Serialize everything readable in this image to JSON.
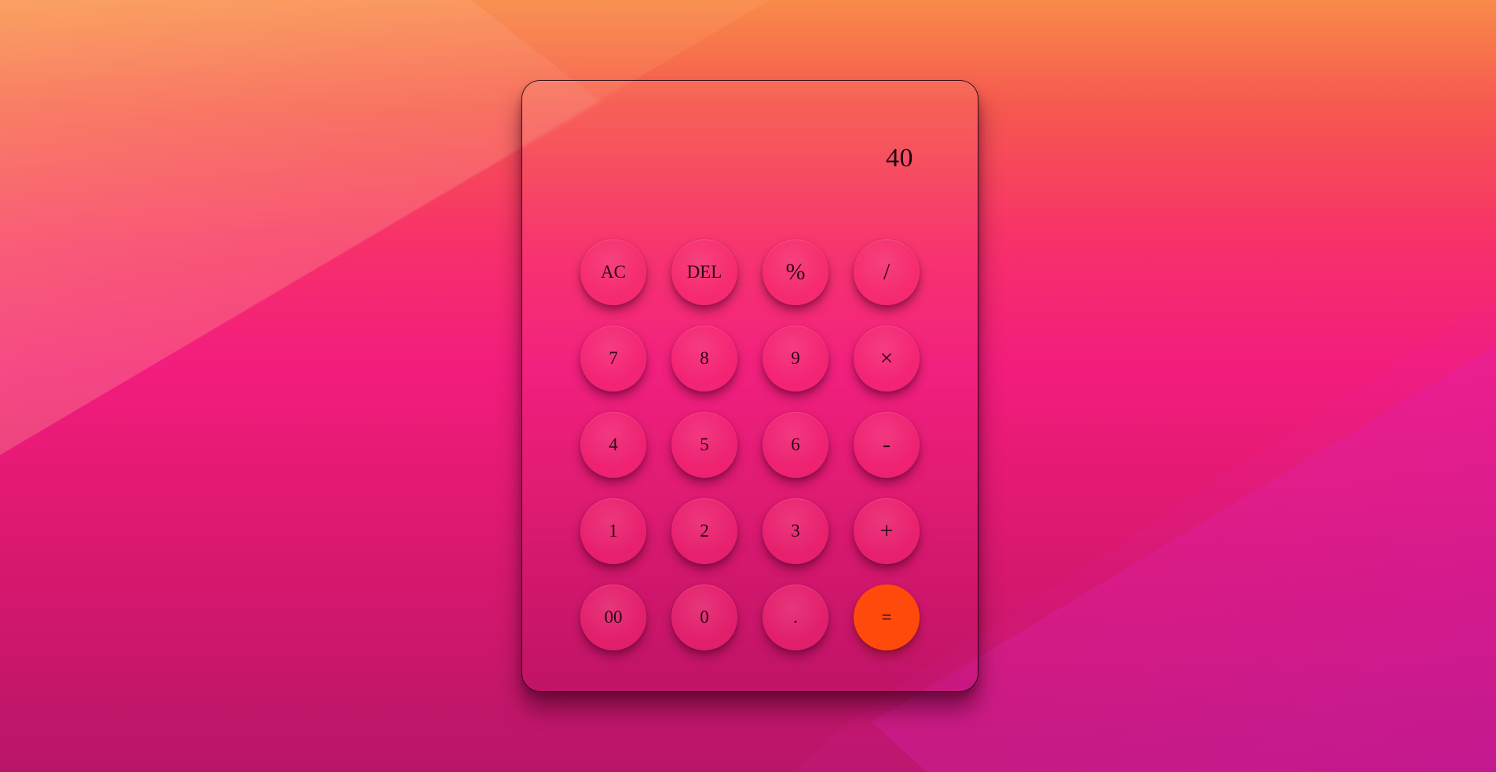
{
  "display": {
    "value": "40"
  },
  "keys": [
    {
      "label": "AC",
      "name": "clear-all-button"
    },
    {
      "label": "DEL",
      "name": "delete-button"
    },
    {
      "label": "%",
      "name": "percent-button"
    },
    {
      "label": "/",
      "name": "divide-button"
    },
    {
      "label": "7",
      "name": "digit-7-button"
    },
    {
      "label": "8",
      "name": "digit-8-button"
    },
    {
      "label": "9",
      "name": "digit-9-button"
    },
    {
      "label": "×",
      "name": "multiply-button"
    },
    {
      "label": "4",
      "name": "digit-4-button"
    },
    {
      "label": "5",
      "name": "digit-5-button"
    },
    {
      "label": "6",
      "name": "digit-6-button"
    },
    {
      "label": "-",
      "name": "subtract-button"
    },
    {
      "label": "1",
      "name": "digit-1-button"
    },
    {
      "label": "2",
      "name": "digit-2-button"
    },
    {
      "label": "3",
      "name": "digit-3-button"
    },
    {
      "label": "+",
      "name": "add-button"
    },
    {
      "label": "00",
      "name": "double-zero-button"
    },
    {
      "label": "0",
      "name": "digit-0-button"
    },
    {
      "label": ".",
      "name": "decimal-button"
    },
    {
      "label": "=",
      "name": "equals-button"
    }
  ],
  "colors": {
    "equals_accent": "#ff4a0c",
    "key_text": "#2a0815"
  }
}
